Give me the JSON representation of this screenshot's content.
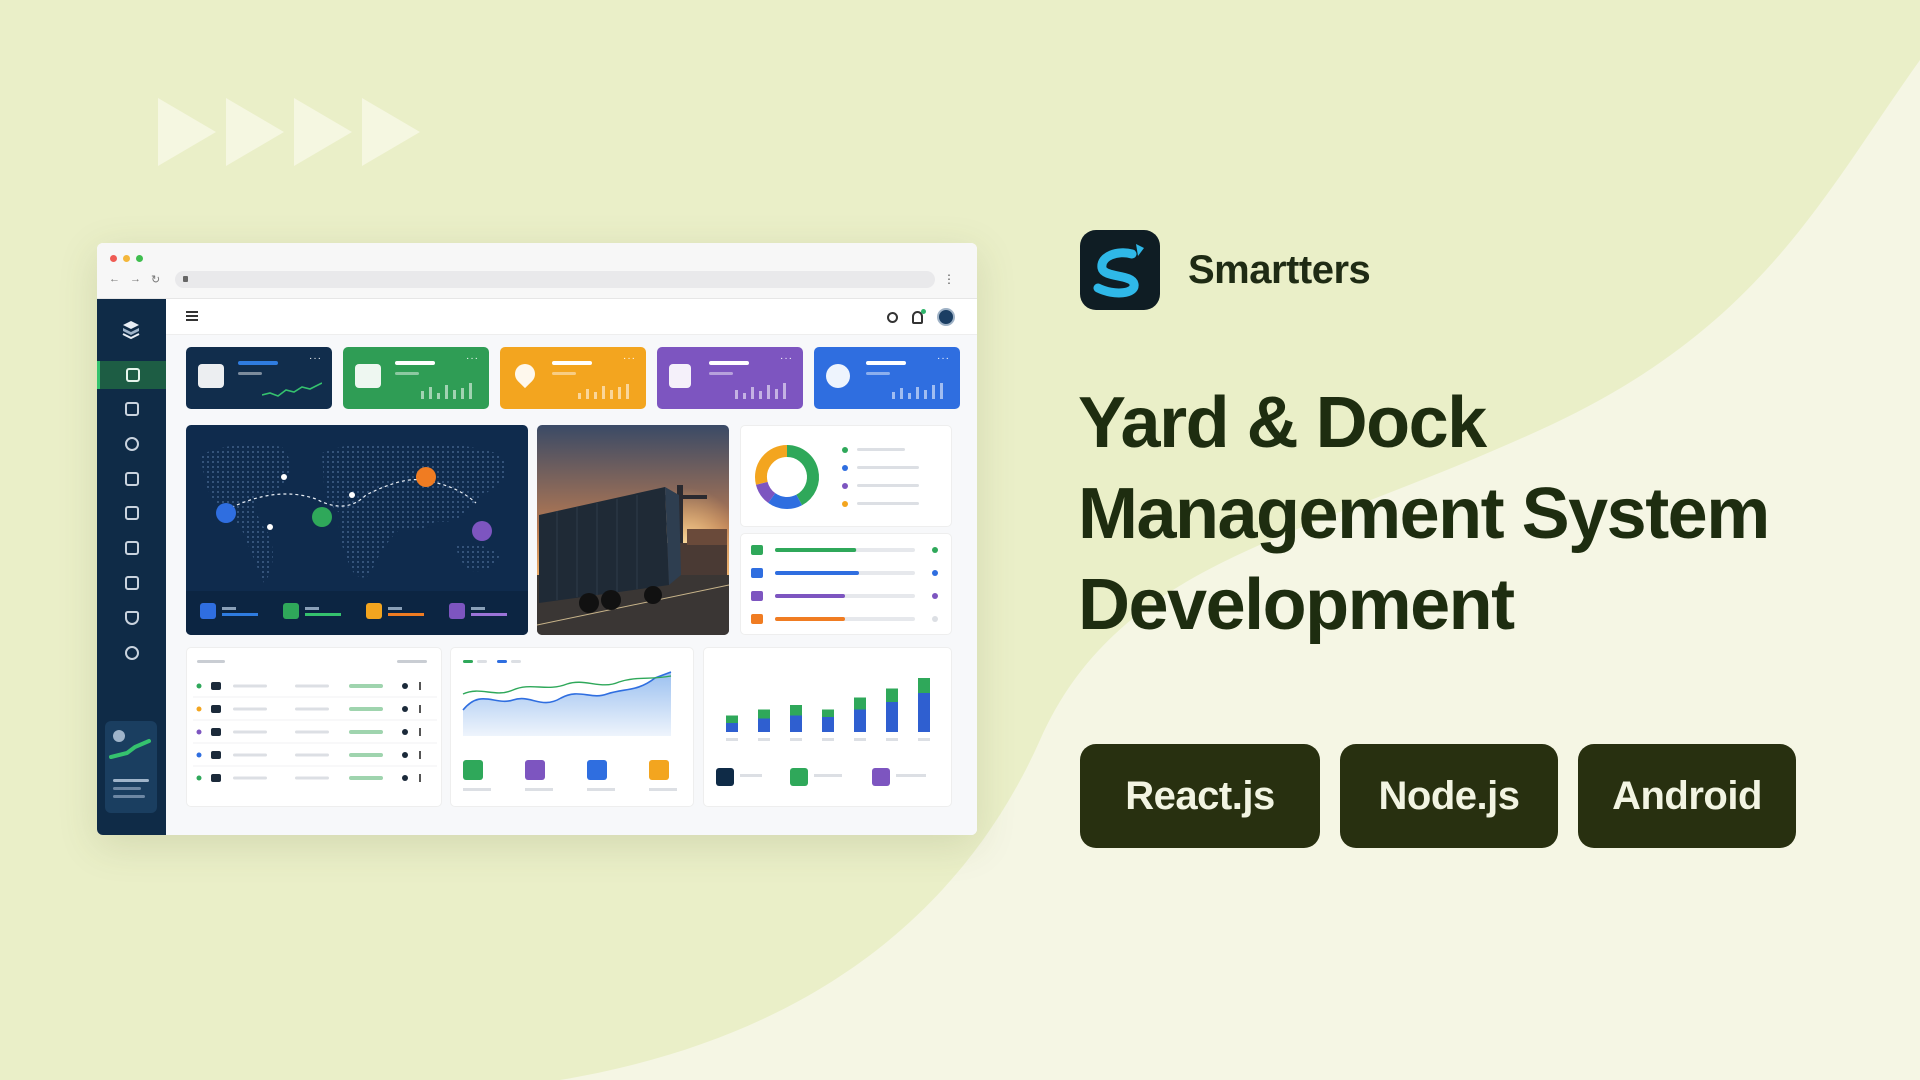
{
  "brand": {
    "name": "Smartters"
  },
  "headline": {
    "line1": "Yard & Dock",
    "line2": "Management System",
    "line3": "Development"
  },
  "tech_tags": [
    "React.js",
    "Node.js",
    "Android"
  ],
  "colors": {
    "background": "#f5f6e4",
    "accent_shape": "#ebefca",
    "heading": "#1e2d10",
    "tag_bg": "#283010",
    "tag_text": "#f2f4e2",
    "sidebar": "#0f2b47",
    "kpi_navy": "#112d4c",
    "kpi_green": "#2f9d55",
    "kpi_orange": "#f3a51f",
    "kpi_purple": "#7d55c0",
    "kpi_blue": "#2f6ee0"
  },
  "dashboard_mock": {
    "kpi_icons": [
      "truck-icon",
      "box-icon",
      "location-pin-icon",
      "clipboard-icon",
      "check-circle-icon"
    ],
    "sidebar_icons": [
      "dashboard-icon",
      "truck-icon",
      "route-icon",
      "box-icon",
      "warehouse-icon",
      "ship-icon",
      "analytics-icon",
      "shield-icon",
      "settings-icon"
    ],
    "donut_segments": [
      {
        "color": "#2fa85a",
        "value": 0.38
      },
      {
        "color": "#2f6ee0",
        "value": 0.16
      },
      {
        "color": "#7d55c0",
        "value": 0.1
      },
      {
        "color": "#f3a51f",
        "value": 0.26
      }
    ],
    "progress_rows": [
      {
        "icon": "truck-icon",
        "color": "#2fa85a",
        "value": 0.58
      },
      {
        "icon": "plane-icon",
        "color": "#2f6ee0",
        "value": 0.6
      },
      {
        "icon": "ship-icon",
        "color": "#7d55c0",
        "value": 0.5
      },
      {
        "icon": "box-icon",
        "color": "#f07c22",
        "value": 0.5
      }
    ],
    "bars": [
      {
        "blue": 12,
        "green": 10
      },
      {
        "blue": 18,
        "green": 12
      },
      {
        "blue": 22,
        "green": 14
      },
      {
        "blue": 20,
        "green": 10
      },
      {
        "blue": 30,
        "green": 16
      },
      {
        "blue": 40,
        "green": 18
      },
      {
        "blue": 52,
        "green": 20
      }
    ]
  }
}
